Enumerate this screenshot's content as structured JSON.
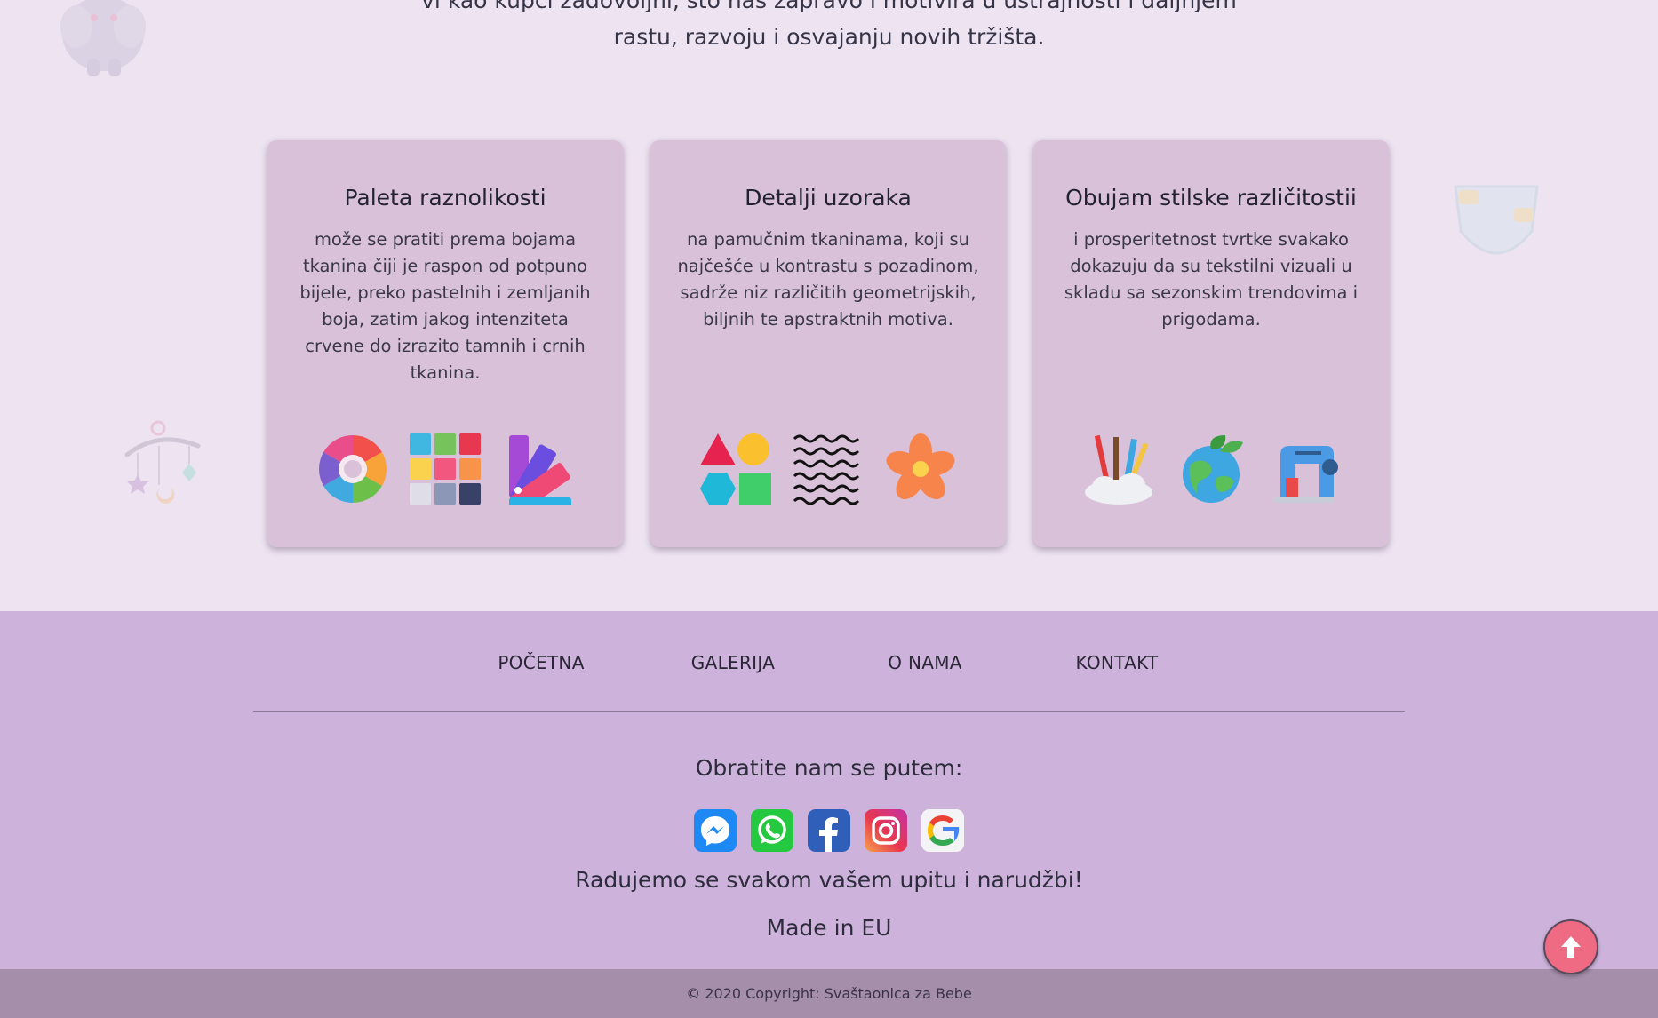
{
  "intro": {
    "line1": "vi kao kupci zadovoljni, što nas zapravo i motivira u ustrajnosti i daljnjem",
    "line2": "rastu, razvoju i osvajanju novih tržišta."
  },
  "cards": [
    {
      "title": "Paleta raznolikosti",
      "text": "može se pratiti prema bojama tkanina čiji je raspon od potpuno bijele, preko pastelnih i zemljanih boja, zatim jakog intenziteta crvene do izrazito tamnih i crnih tkanina.",
      "icons": [
        "color-wheel-icon",
        "color-swatches-icon",
        "color-fan-icon"
      ]
    },
    {
      "title": "Detalji uzoraka",
      "text": "na pamučnim tkaninama, koji su najčešće u kontrastu s pozadinom, sadrže niz različitih geometrijskih, biljnih te apstraktnih motiva.",
      "icons": [
        "geometric-shapes-icon",
        "wavy-lines-icon",
        "flower-icon"
      ]
    },
    {
      "title": "Obujam stilske različitostii",
      "text": "i prosperitetnost tvrtke svakako dokazuju da su tekstilni vizuali u skladu sa sezonskim trendovima i prigodama.",
      "icons": [
        "art-supplies-icon",
        "eco-globe-icon",
        "sewing-machine-icon"
      ]
    }
  ],
  "footer": {
    "nav": [
      "POČETNA",
      "GALERIJA",
      "O NAMA",
      "KONTAKT"
    ],
    "reach_text": "Obratite nam se putem:",
    "social": [
      "messenger-icon",
      "whatsapp-icon",
      "facebook-icon",
      "instagram-icon",
      "google-icon"
    ],
    "happy_text": "Radujemo se svakom vašem upitu i narudžbi!",
    "made_text": "Made in EU",
    "copyright": "© 2020 Copyright: Svaštaonica za Bebe"
  },
  "colors": {
    "page_bg": "#ede3f1",
    "card_bg": "#d9c1da",
    "footer_bg": "#cdb3db",
    "copyright_bg": "#a48eaa",
    "scroll_top": "#ef6b84"
  }
}
